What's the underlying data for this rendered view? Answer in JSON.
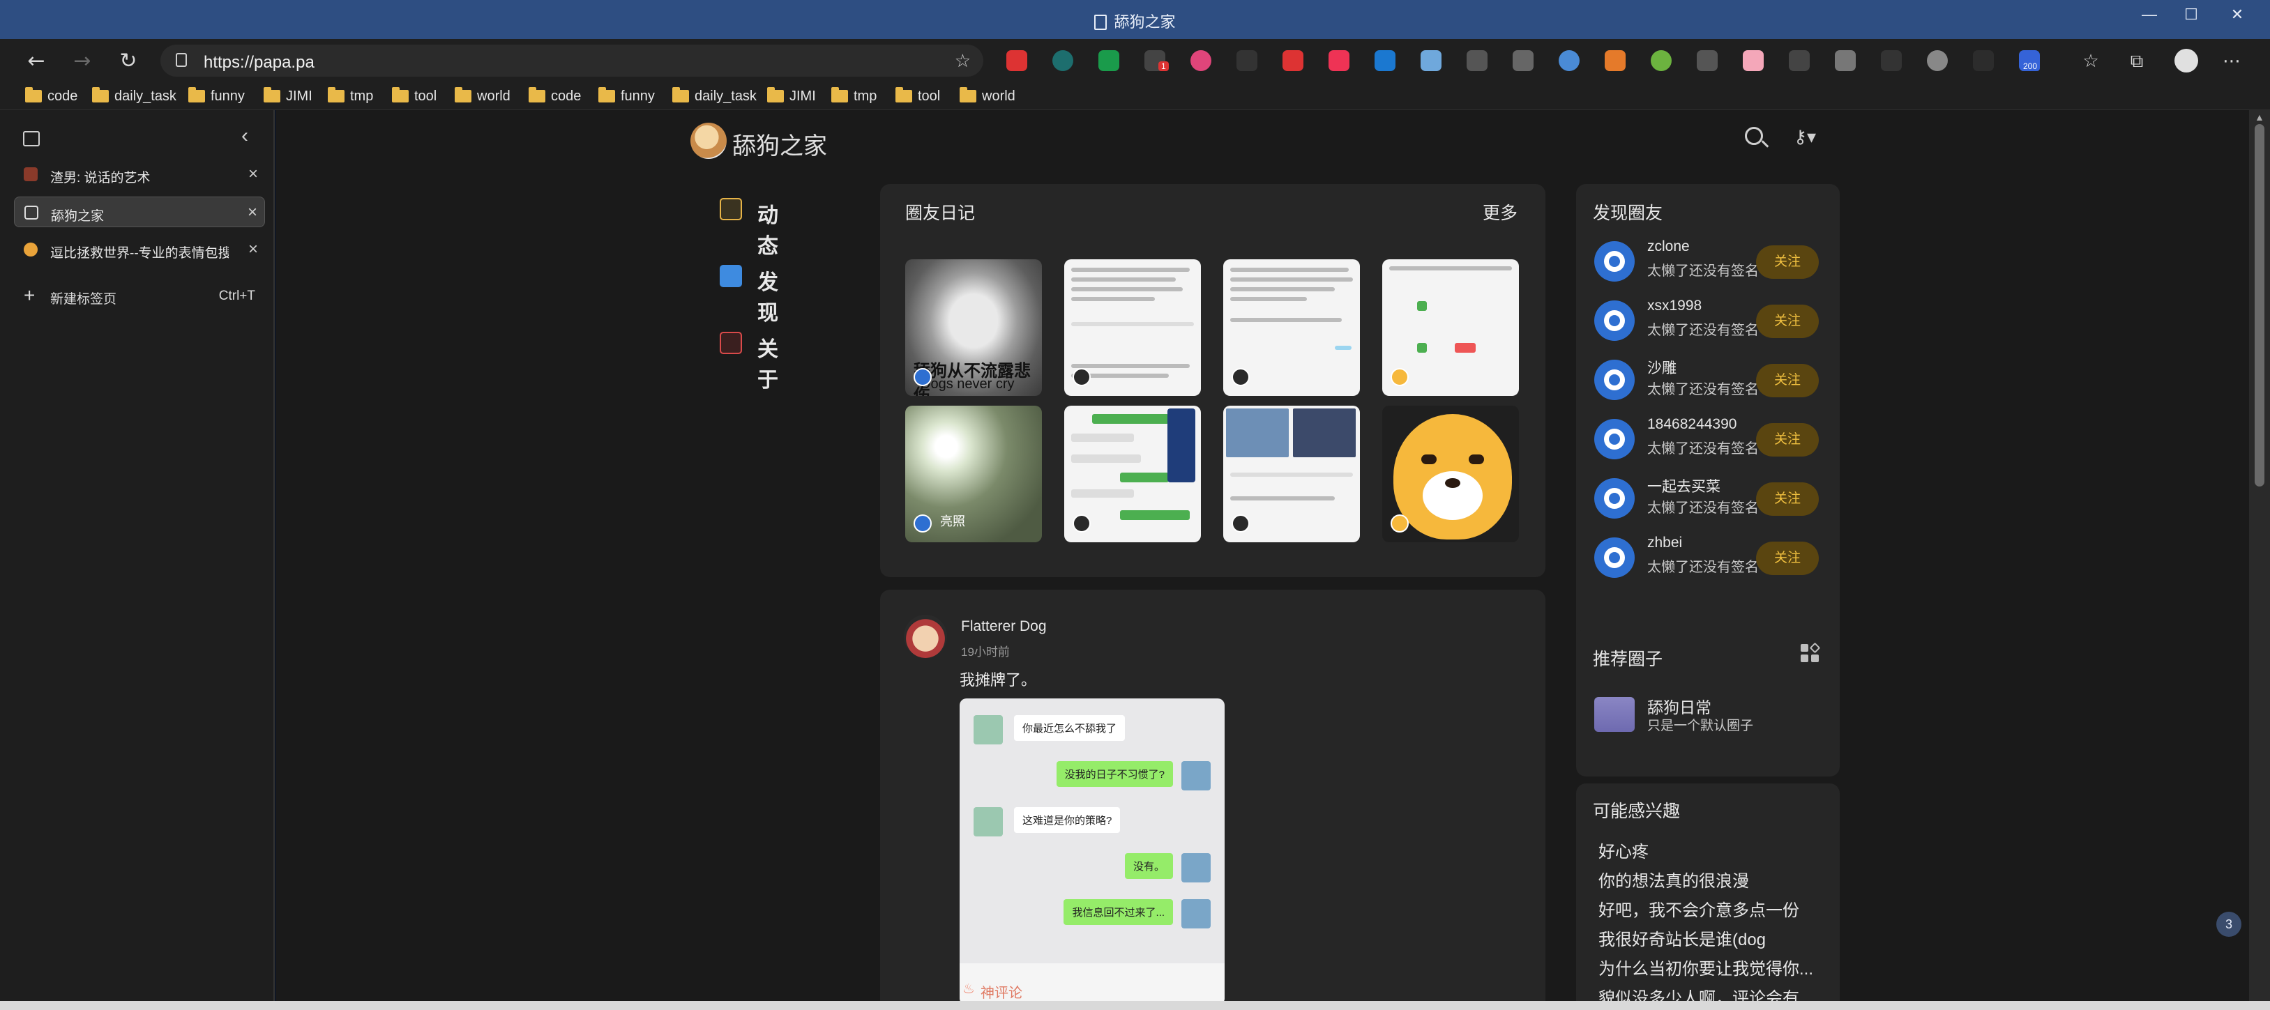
{
  "window": {
    "title": "舔狗之家",
    "controls": [
      "—",
      "☐",
      "✕"
    ]
  },
  "addressbar": {
    "url": "https://papa.pa"
  },
  "extensions": {
    "badge_count": "1",
    "badge_count_2": "200"
  },
  "bookmarks": [
    "code",
    "daily_task",
    "funny",
    "JIMI",
    "tmp",
    "tool",
    "world",
    "code",
    "funny",
    "daily_task",
    "JIMI",
    "tmp",
    "tool",
    "world"
  ],
  "sidebar": {
    "tabs": [
      {
        "label": "渣男: 说话的艺术",
        "active": false
      },
      {
        "label": "舔狗之家",
        "active": true
      },
      {
        "label": "逗比拯救世界--专业的表情包搜索",
        "active": false
      }
    ],
    "new_tab": {
      "label": "新建标签页",
      "shortcut": "Ctrl+T"
    }
  },
  "site": {
    "name": "舔狗之家",
    "nav": [
      {
        "label": "动态",
        "color": "#e6b347"
      },
      {
        "label": "发现",
        "color": "#3e8be0"
      },
      {
        "label": "关于",
        "color": "#d94a4a"
      }
    ]
  },
  "diary": {
    "title": "圈友日记",
    "more": "更多",
    "thumb_captions": {
      "dog_line1": "舔狗从不流露悲伤",
      "dog_line2": "Dogs never cry",
      "flower": "亮照"
    }
  },
  "post": {
    "author": "Flatterer Dog",
    "time": "19小时前",
    "text": "我摊牌了。",
    "chat": [
      {
        "side": "l",
        "text": "你最近怎么不舔我了"
      },
      {
        "side": "r",
        "text": "没我的日子不习惯了?"
      },
      {
        "side": "l",
        "text": "这难道是你的策略?"
      },
      {
        "side": "r",
        "text": "没有。"
      },
      {
        "side": "r",
        "text": "我信息回不过来了..."
      }
    ],
    "hot_comment": "神评论"
  },
  "discover": {
    "title": "发现圈友",
    "follow_label": "关注",
    "users": [
      {
        "name": "zclone",
        "desc": "太懒了还没有签名"
      },
      {
        "name": "xsx1998",
        "desc": "太懒了还没有签名"
      },
      {
        "name": "沙雕",
        "desc": "太懒了还没有签名"
      },
      {
        "name": "18468244390",
        "desc": "太懒了还没有签名"
      },
      {
        "name": "一起去买菜",
        "desc": "太懒了还没有签名"
      },
      {
        "name": "zhbei",
        "desc": "太懒了还没有签名"
      }
    ]
  },
  "circles": {
    "title": "推荐圈子",
    "items": [
      {
        "name": "舔狗日常",
        "desc": "只是一个默认圈子"
      }
    ]
  },
  "interests": {
    "title": "可能感兴趣",
    "items": [
      "好心疼",
      "你的想法真的很浪漫",
      "好吧，我不会介意多点一份",
      "我很好奇站长是谁(dog",
      "为什么当初你要让我觉得你...",
      "貌似没多少人啊，评论会有..."
    ]
  },
  "floating_badge": "3"
}
